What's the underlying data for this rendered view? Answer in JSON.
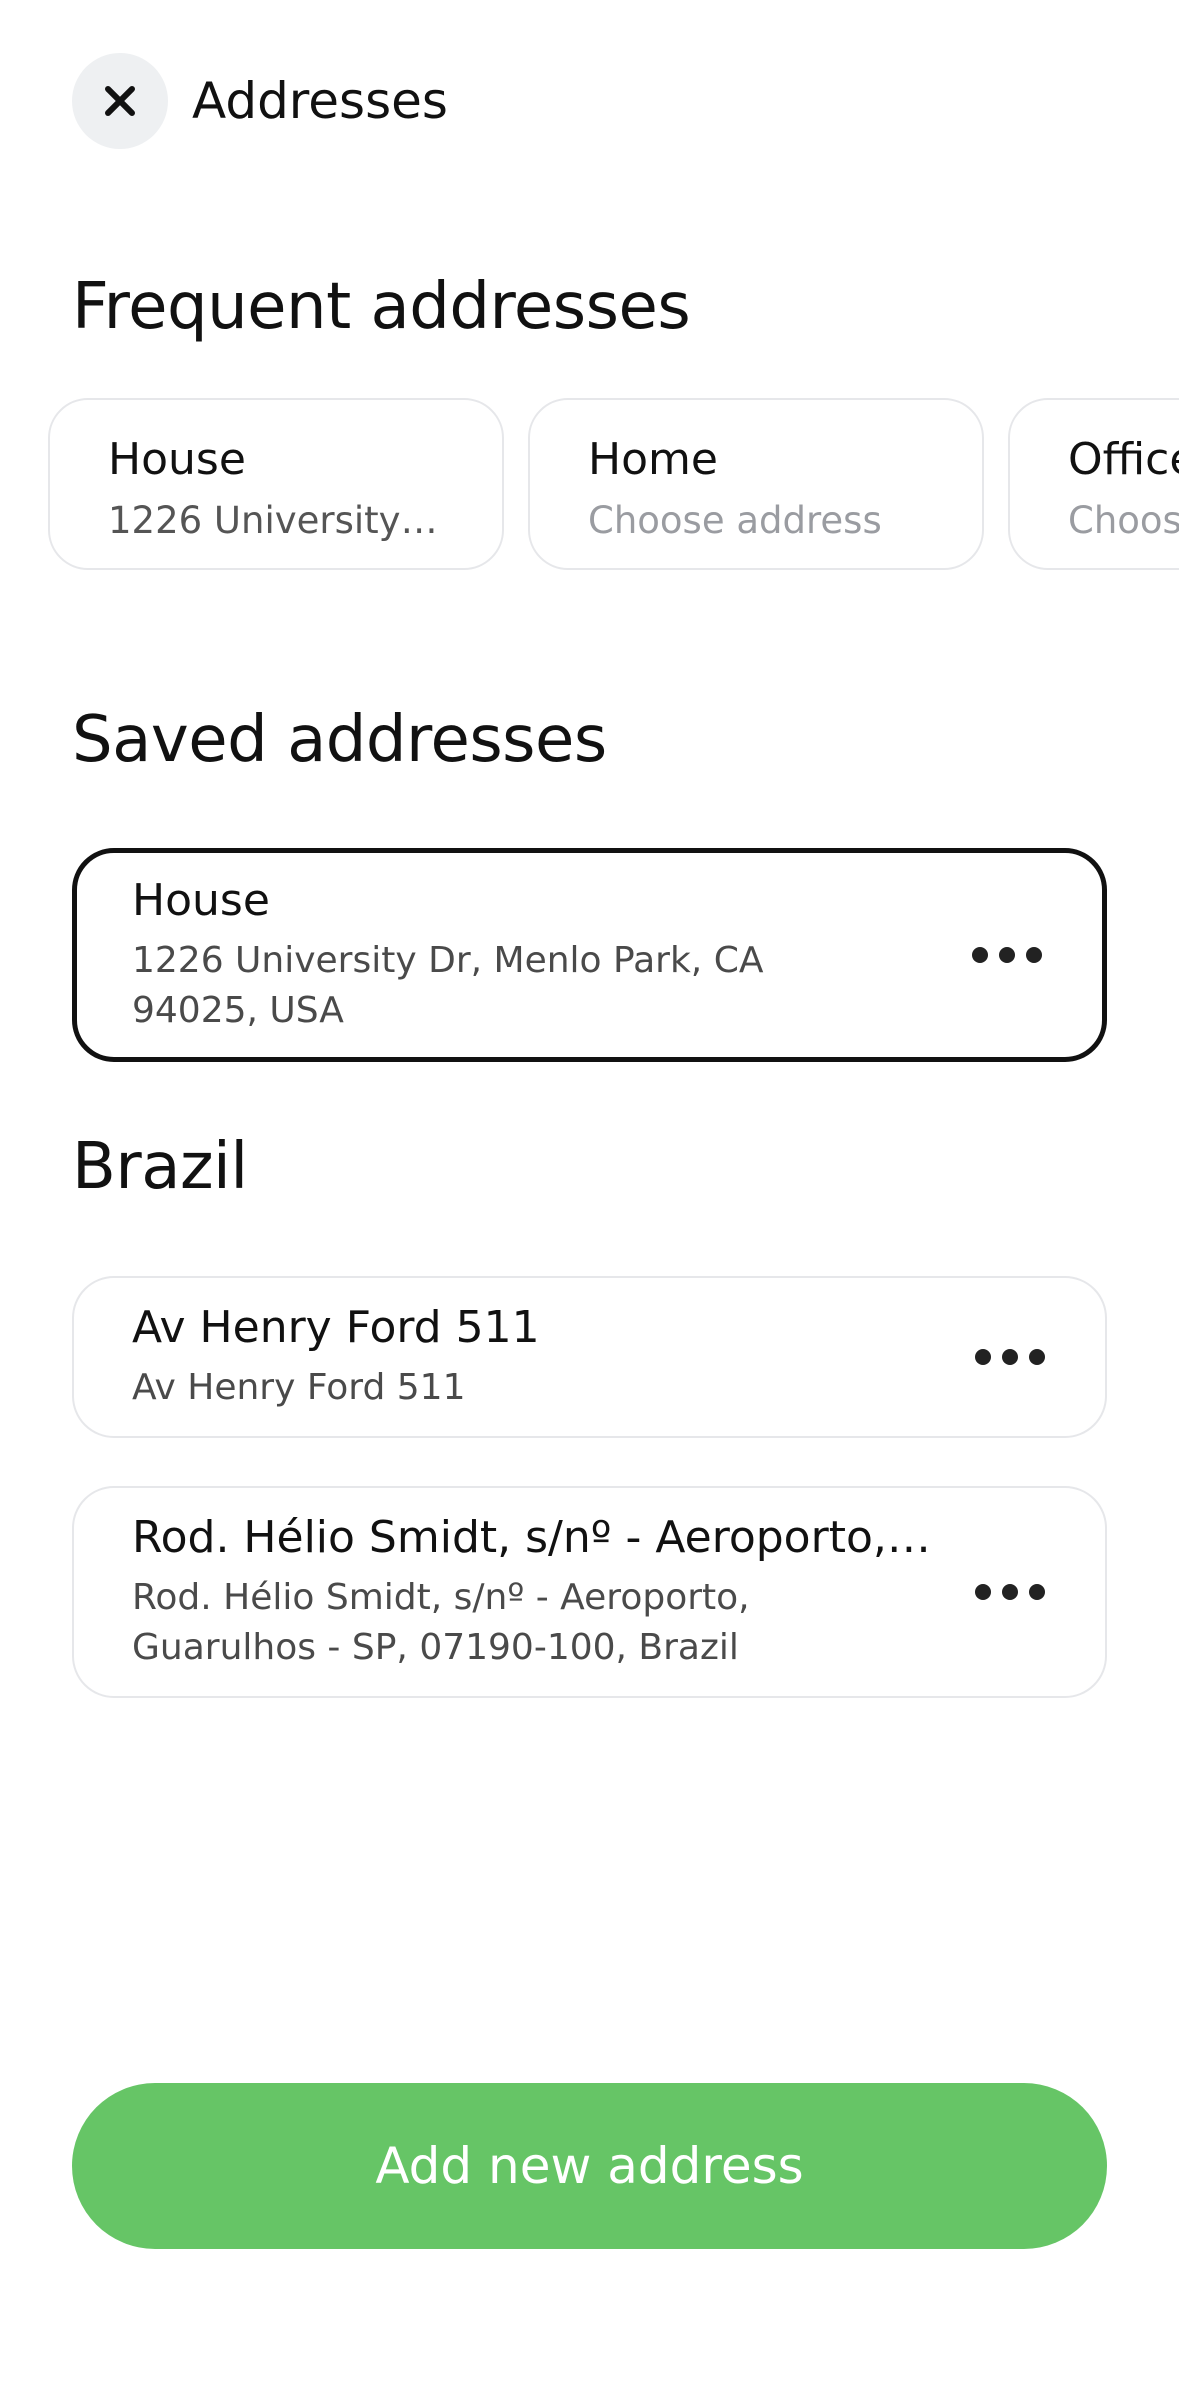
{
  "header": {
    "title": "Addresses"
  },
  "frequent": {
    "title": "Frequent addresses",
    "items": [
      {
        "label": "House",
        "value": "1226 University…"
      },
      {
        "label": "Home",
        "value": "Choose address"
      },
      {
        "label": "Office",
        "value": "Choose address"
      }
    ]
  },
  "saved": {
    "title": "Saved addresses",
    "items": [
      {
        "title": "House",
        "line1": "1226 University Dr, Menlo Park, CA",
        "line2": "94025, USA"
      }
    ]
  },
  "brazil": {
    "title": "Brazil",
    "items": [
      {
        "title": "Av Henry Ford 511",
        "line1": "Av Henry Ford 511"
      },
      {
        "title": "Rod. Hélio Smidt, s/nº - Aeroporto,…",
        "line1": "Rod. Hélio Smidt, s/nº - Aeroporto,",
        "line2": "Guarulhos - SP, 07190-100, Brazil"
      }
    ]
  },
  "add_button": {
    "label": "Add new address"
  },
  "colors": {
    "accent": "#66c566",
    "selected_border": "#111111",
    "card_border": "#e6e7ea"
  }
}
